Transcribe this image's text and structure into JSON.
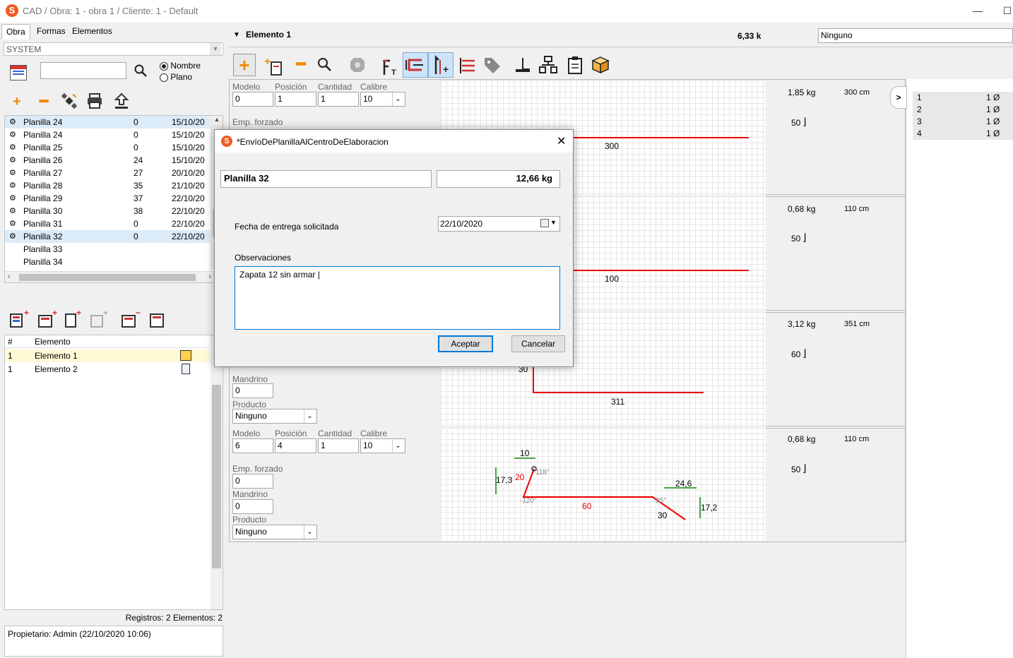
{
  "window": {
    "title": "CAD / Obra: 1 - obra 1 / Cliente: 1 - Default",
    "minimize": "—",
    "maximize": "☐"
  },
  "tabs": [
    "Obra",
    "Formas",
    "Elementos"
  ],
  "left": {
    "combo": "SYSTEM",
    "radio_nombre": "Nombre",
    "radio_plano": "Plano",
    "planillas": [
      {
        "name": "Planilla 24",
        "num": "0",
        "date": "15/10/20"
      },
      {
        "name": "Planilla 24",
        "num": "0",
        "date": "15/10/20"
      },
      {
        "name": "Planilla 25",
        "num": "0",
        "date": "15/10/20"
      },
      {
        "name": "Planilla 26",
        "num": "24",
        "date": "15/10/20"
      },
      {
        "name": "Planilla 27",
        "num": "27",
        "date": "20/10/20"
      },
      {
        "name": "Planilla 28",
        "num": "35",
        "date": "21/10/20"
      },
      {
        "name": "Planilla 29",
        "num": "37",
        "date": "22/10/20"
      },
      {
        "name": "Planilla 30",
        "num": "38",
        "date": "22/10/20"
      },
      {
        "name": "Planilla 31",
        "num": "0",
        "date": "22/10/20"
      },
      {
        "name": "Planilla 32",
        "num": "0",
        "date": "22/10/20"
      },
      {
        "name": "Planilla 33",
        "num": "",
        "date": ""
      },
      {
        "name": "Planilla 34",
        "num": "",
        "date": ""
      }
    ],
    "elem_header": {
      "hash": "#",
      "elemento": "Elemento"
    },
    "elementos": [
      {
        "num": "1",
        "name": "Elemento 1"
      },
      {
        "num": "1",
        "name": "Elemento 2"
      }
    ],
    "status": "Registros: 2  Elementos: 2",
    "owner": "Propietario: Admin (22/10/2020 10:06)"
  },
  "header": {
    "element": "Elemento 1",
    "weight": "6,33 k",
    "ninguno": "Ninguno"
  },
  "labels": {
    "modelo": "Modelo",
    "posicion": "Posición",
    "cantidad": "Cantidad",
    "calibre": "Calibre",
    "emp": "Emp. forzado",
    "mandrino": "Mandrino",
    "producto": "Producto"
  },
  "panels": [
    {
      "modelo": "0",
      "posicion": "1",
      "cantidad": "1",
      "calibre": "10",
      "emp": "",
      "weight": "1,85 kg",
      "length": "300 cm",
      "factor": "50",
      "dims": [
        "300"
      ]
    },
    {
      "weight": "0,68 kg",
      "length": "110 cm",
      "factor": "50",
      "dims": [
        "100"
      ]
    },
    {
      "mandrino": "0",
      "producto": "Ninguno",
      "weight": "3,12 kg",
      "length": "351 cm",
      "factor": "60",
      "dims": [
        "30",
        "311"
      ]
    },
    {
      "modelo": "6",
      "posicion": "4",
      "cantidad": "1",
      "calibre": "10",
      "emp": "0",
      "mandrino": "0",
      "producto": "Ninguno",
      "weight": "0,68 kg",
      "length": "110 cm",
      "factor": "50",
      "dims": {
        "d10": "10",
        "d173": "17,3",
        "d20": "20",
        "a118": "118°",
        "a120": "-120°",
        "d60": "60",
        "d246": "24,6",
        "a35": "35°",
        "d30": "30",
        "d172": "17,2"
      }
    }
  ],
  "side_list": [
    {
      "n": "1",
      "v": "1 Ø"
    },
    {
      "n": "2",
      "v": "1 Ø"
    },
    {
      "n": "3",
      "v": "1 Ø"
    },
    {
      "n": "4",
      "v": "1 Ø"
    }
  ],
  "side_toggle": ">",
  "dialog": {
    "title": "*EnvíoDePlanillaAlCentroDeElaboracion",
    "planilla": "Planilla 32",
    "weight": "12,66 kg",
    "fecha_label": "Fecha de entrega solicitada",
    "fecha": "22/10/2020",
    "obs_label": "Observaciones",
    "obs": "Zapata 12  sin armar |",
    "accept": "Aceptar",
    "cancel": "Cancelar",
    "close": "✕"
  },
  "colors": {
    "accent": "#0078d7",
    "shape": "#e00000",
    "dimension": "#0a8a0a",
    "logo": "#f05a22"
  }
}
